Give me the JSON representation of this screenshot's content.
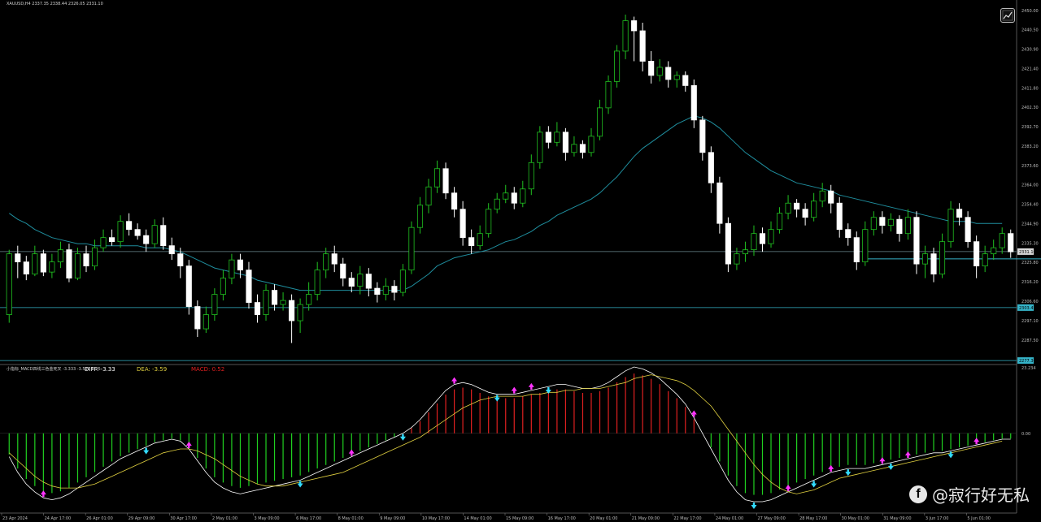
{
  "header": {
    "symbol_line": "XAUUSD,H4  2337.35 2338.44 2326.05 2331.10"
  },
  "indicator": {
    "name": "小指标_MACD四线三色金死叉 -3.333 -3.590 0.25",
    "diff": "DIFF: -3.33",
    "dea": "DEA: -3.59",
    "macd": "MACD: 0.52"
  },
  "watermark": "@寂行好无私",
  "colors": {
    "background": "#000000",
    "bull": "#20c020",
    "bear": "#ffffff",
    "ma": "#1f8e9e",
    "hline": "#35b3c8",
    "hist_pos": "#e02020",
    "hist_neg": "#20d020",
    "diff_line": "#ffffff",
    "dea_line": "#e0d040",
    "arrow_up": "#ff33ff",
    "arrow_down": "#33ddff"
  },
  "chart_data": {
    "type": "candlestick",
    "price_axis_labels": [
      "2450.00",
      "2440.50",
      "2430.90",
      "2421.40",
      "2411.80",
      "2402.30",
      "2392.70",
      "2383.20",
      "2373.60",
      "2364.00",
      "2354.40",
      "2344.90",
      "2335.30",
      "2325.80",
      "2316.20",
      "2306.60",
      "2297.10",
      "2287.50"
    ],
    "price_badges": [
      "2331.10",
      "2303.47",
      "2277.36"
    ],
    "indicator_axis_labels": [
      "23.234",
      "0.00"
    ],
    "time_labels": [
      "23 Apr 2024",
      "24 Apr 17:00",
      "26 Apr 01:00",
      "29 Apr 09:00",
      "30 Apr 17:00",
      "2 May 01:00",
      "3 May 09:00",
      "6 May 17:00",
      "8 May 01:00",
      "9 May 09:00",
      "10 May 17:00",
      "14 May 01:00",
      "15 May 09:00",
      "16 May 17:00",
      "20 May 01:00",
      "21 May 09:00",
      "22 May 17:00",
      "24 May 01:00",
      "27 May 09:00",
      "28 May 17:00",
      "30 May 01:00",
      "31 May 09:00",
      "3 Jun 17:00",
      "5 Jun 01:00"
    ],
    "y_range": [
      2277,
      2452
    ],
    "hlines": [
      2331.1,
      2303.47,
      2277.36
    ],
    "segments": [
      {
        "x0": 100,
        "x1": 122,
        "y": 2327.5
      },
      {
        "x0": 121,
        "x1": 143,
        "y": 2366.0
      },
      {
        "x0": 144,
        "x1": 162,
        "y": 2323.0
      },
      {
        "x0": 149,
        "x1": 169,
        "y": 2362.0
      },
      {
        "x0": 161,
        "x1": 183,
        "y": 2357.0
      },
      {
        "x0": 152,
        "x1": 172,
        "y": 2318.0
      }
    ],
    "macd_range": [
      -40,
      34
    ],
    "candles": [
      [
        2300,
        2330,
        2296,
        2332
      ],
      [
        2330,
        2326,
        2318,
        2334
      ],
      [
        2326,
        2320,
        2317,
        2329
      ],
      [
        2320,
        2330,
        2319,
        2334
      ],
      [
        2330,
        2321,
        2319,
        2332
      ],
      [
        2321,
        2326,
        2318,
        2330
      ],
      [
        2326,
        2332,
        2323,
        2336
      ],
      [
        2332,
        2318,
        2316,
        2335
      ],
      [
        2318,
        2330,
        2317,
        2333
      ],
      [
        2330,
        2324,
        2321,
        2334
      ],
      [
        2324,
        2333,
        2322,
        2337
      ],
      [
        2333,
        2338,
        2331,
        2342
      ],
      [
        2338,
        2336,
        2334,
        2342
      ],
      [
        2336,
        2346,
        2333,
        2349
      ],
      [
        2346,
        2342,
        2339,
        2350
      ],
      [
        2342,
        2339,
        2337,
        2345
      ],
      [
        2339,
        2335,
        2331,
        2342
      ],
      [
        2335,
        2344,
        2333,
        2347
      ],
      [
        2344,
        2334,
        2332,
        2348
      ],
      [
        2334,
        2330,
        2327,
        2338
      ],
      [
        2330,
        2324,
        2318,
        2333
      ],
      [
        2324,
        2304,
        2300,
        2327
      ],
      [
        2304,
        2293,
        2289,
        2307
      ],
      [
        2293,
        2300,
        2291,
        2304
      ],
      [
        2300,
        2310,
        2297,
        2313
      ],
      [
        2310,
        2318,
        2307,
        2322
      ],
      [
        2318,
        2327,
        2315,
        2330
      ],
      [
        2327,
        2322,
        2318,
        2330
      ],
      [
        2322,
        2306,
        2303,
        2326
      ],
      [
        2306,
        2300,
        2296,
        2310
      ],
      [
        2300,
        2312,
        2297,
        2315
      ],
      [
        2312,
        2305,
        2302,
        2315
      ],
      [
        2305,
        2307,
        2302,
        2311
      ],
      [
        2307,
        2297,
        2286,
        2310
      ],
      [
        2297,
        2305,
        2291,
        2308
      ],
      [
        2305,
        2310,
        2302,
        2316
      ],
      [
        2310,
        2322,
        2307,
        2326
      ],
      [
        2322,
        2330,
        2318,
        2333
      ],
      [
        2330,
        2325,
        2321,
        2334
      ],
      [
        2325,
        2318,
        2314,
        2328
      ],
      [
        2318,
        2314,
        2311,
        2321
      ],
      [
        2314,
        2320,
        2310,
        2324
      ],
      [
        2320,
        2313,
        2309,
        2323
      ],
      [
        2313,
        2310,
        2306,
        2316
      ],
      [
        2310,
        2314,
        2307,
        2318
      ],
      [
        2314,
        2311,
        2307,
        2317
      ],
      [
        2311,
        2322,
        2309,
        2325
      ],
      [
        2322,
        2343,
        2320,
        2346
      ],
      [
        2343,
        2354,
        2340,
        2358
      ],
      [
        2354,
        2363,
        2350,
        2367
      ],
      [
        2363,
        2372,
        2360,
        2376
      ],
      [
        2372,
        2360,
        2357,
        2375
      ],
      [
        2360,
        2352,
        2348,
        2363
      ],
      [
        2352,
        2338,
        2334,
        2356
      ],
      [
        2338,
        2334,
        2330,
        2342
      ],
      [
        2334,
        2340,
        2332,
        2344
      ],
      [
        2340,
        2352,
        2338,
        2355
      ],
      [
        2352,
        2357,
        2350,
        2360
      ],
      [
        2357,
        2360,
        2355,
        2364
      ],
      [
        2360,
        2355,
        2352,
        2363
      ],
      [
        2355,
        2362,
        2353,
        2366
      ],
      [
        2362,
        2375,
        2359,
        2379
      ],
      [
        2375,
        2390,
        2372,
        2393
      ],
      [
        2390,
        2385,
        2382,
        2393
      ],
      [
        2385,
        2390,
        2383,
        2395
      ],
      [
        2390,
        2380,
        2376,
        2392
      ],
      [
        2380,
        2384,
        2378,
        2388
      ],
      [
        2384,
        2380,
        2377,
        2386
      ],
      [
        2380,
        2388,
        2378,
        2392
      ],
      [
        2388,
        2402,
        2386,
        2406
      ],
      [
        2402,
        2415,
        2399,
        2418
      ],
      [
        2415,
        2430,
        2412,
        2433
      ],
      [
        2430,
        2445,
        2426,
        2448
      ],
      [
        2445,
        2440,
        2425,
        2447
      ],
      [
        2440,
        2425,
        2420,
        2444
      ],
      [
        2425,
        2418,
        2414,
        2430
      ],
      [
        2418,
        2422,
        2415,
        2426
      ],
      [
        2422,
        2416,
        2412,
        2425
      ],
      [
        2416,
        2418,
        2412,
        2420
      ],
      [
        2418,
        2413,
        2410,
        2420
      ],
      [
        2413,
        2396,
        2392,
        2416
      ],
      [
        2396,
        2380,
        2376,
        2398
      ],
      [
        2380,
        2365,
        2360,
        2383
      ],
      [
        2365,
        2345,
        2340,
        2368
      ],
      [
        2345,
        2325,
        2321,
        2348
      ],
      [
        2325,
        2330,
        2322,
        2333
      ],
      [
        2330,
        2332,
        2326,
        2336
      ],
      [
        2332,
        2340,
        2329,
        2344
      ],
      [
        2340,
        2335,
        2331,
        2343
      ],
      [
        2335,
        2342,
        2333,
        2346
      ],
      [
        2342,
        2350,
        2340,
        2353
      ],
      [
        2350,
        2355,
        2347,
        2359
      ],
      [
        2355,
        2352,
        2348,
        2357
      ],
      [
        2352,
        2348,
        2344,
        2355
      ],
      [
        2348,
        2356,
        2346,
        2360
      ],
      [
        2356,
        2361,
        2353,
        2365
      ],
      [
        2361,
        2355,
        2350,
        2364
      ],
      [
        2355,
        2342,
        2338,
        2358
      ],
      [
        2342,
        2338,
        2334,
        2345
      ],
      [
        2338,
        2326,
        2322,
        2341
      ],
      [
        2326,
        2342,
        2324,
        2346
      ],
      [
        2342,
        2348,
        2339,
        2351
      ],
      [
        2348,
        2344,
        2340,
        2351
      ],
      [
        2344,
        2347,
        2341,
        2350
      ],
      [
        2347,
        2340,
        2336,
        2349
      ],
      [
        2340,
        2348,
        2337,
        2352
      ],
      [
        2348,
        2325,
        2320,
        2351
      ],
      [
        2325,
        2330,
        2318,
        2334
      ],
      [
        2330,
        2320,
        2316,
        2333
      ],
      [
        2320,
        2336,
        2318,
        2340
      ],
      [
        2336,
        2352,
        2333,
        2356
      ],
      [
        2352,
        2348,
        2344,
        2355
      ],
      [
        2348,
        2336,
        2333,
        2351
      ],
      [
        2336,
        2324,
        2318,
        2339
      ],
      [
        2324,
        2330,
        2321,
        2334
      ],
      [
        2330,
        2333,
        2327,
        2337
      ],
      [
        2333,
        2340,
        2330,
        2343
      ],
      [
        2340,
        2331,
        2328,
        2342
      ]
    ],
    "ma": [
      2350,
      2347,
      2345,
      2342,
      2340,
      2338,
      2337,
      2336,
      2335,
      2335,
      2334,
      2334,
      2334,
      2334,
      2334,
      2334,
      2333,
      2333,
      2333,
      2332,
      2331,
      2329,
      2327,
      2325,
      2323,
      2322,
      2321,
      2320,
      2319,
      2317,
      2316,
      2315,
      2314,
      2313,
      2312,
      2312,
      2312,
      2312,
      2312,
      2312,
      2312,
      2312,
      2312,
      2312,
      2312,
      2312,
      2312,
      2314,
      2317,
      2320,
      2324,
      2326,
      2328,
      2329,
      2330,
      2331,
      2332,
      2334,
      2336,
      2337,
      2339,
      2341,
      2344,
      2346,
      2349,
      2351,
      2353,
      2355,
      2357,
      2360,
      2364,
      2368,
      2373,
      2378,
      2382,
      2385,
      2388,
      2391,
      2394,
      2396,
      2398,
      2397,
      2395,
      2392,
      2388,
      2384,
      2380,
      2377,
      2374,
      2371,
      2369,
      2367,
      2365,
      2364,
      2363,
      2362,
      2361,
      2359,
      2358,
      2357,
      2356,
      2355,
      2354,
      2353,
      2352,
      2351,
      2350,
      2349,
      2348,
      2347,
      2346,
      2346,
      2346,
      2345,
      2345,
      2345,
      2345
    ],
    "diff": [
      -12,
      -20,
      -26,
      -30,
      -33,
      -34,
      -33,
      -31,
      -28,
      -25,
      -22,
      -19,
      -16,
      -13,
      -11,
      -9,
      -7,
      -5,
      -4,
      -3,
      -4,
      -8,
      -14,
      -20,
      -25,
      -28,
      -30,
      -31,
      -30,
      -29,
      -28,
      -27,
      -26,
      -25,
      -24,
      -22,
      -20,
      -18,
      -16,
      -14,
      -12,
      -10,
      -8,
      -6,
      -4,
      -2,
      0,
      3,
      7,
      12,
      17,
      22,
      25,
      26,
      25,
      23,
      21,
      20,
      20,
      20,
      21,
      22,
      23,
      24,
      25,
      25,
      24,
      23,
      23,
      24,
      26,
      29,
      32,
      34,
      33,
      31,
      28,
      24,
      20,
      15,
      8,
      0,
      -8,
      -16,
      -24,
      -30,
      -34,
      -35,
      -35,
      -34,
      -32,
      -30,
      -28,
      -26,
      -24,
      -22,
      -20,
      -19,
      -18,
      -18,
      -18,
      -17,
      -16,
      -15,
      -14,
      -13,
      -12,
      -11,
      -10,
      -10,
      -9,
      -8,
      -7,
      -6,
      -5,
      -4,
      -3,
      -3
    ],
    "dea": [
      -10,
      -14,
      -18,
      -22,
      -25,
      -27,
      -28,
      -28,
      -28,
      -27,
      -26,
      -24,
      -22,
      -20,
      -18,
      -16,
      -14,
      -12,
      -10,
      -9,
      -8,
      -8,
      -9,
      -11,
      -13,
      -16,
      -19,
      -22,
      -24,
      -26,
      -27,
      -27,
      -27,
      -26,
      -25,
      -24,
      -23,
      -22,
      -21,
      -20,
      -18,
      -16,
      -14,
      -12,
      -10,
      -8,
      -6,
      -4,
      -2,
      1,
      4,
      7,
      10,
      13,
      15,
      17,
      18,
      19,
      19,
      19,
      19,
      20,
      20,
      21,
      21,
      22,
      22,
      23,
      23,
      23,
      24,
      25,
      26,
      28,
      29,
      30,
      29,
      28,
      27,
      25,
      22,
      18,
      14,
      8,
      2,
      -4,
      -10,
      -16,
      -21,
      -25,
      -28,
      -30,
      -31,
      -30,
      -29,
      -27,
      -25,
      -23,
      -22,
      -21,
      -20,
      -19,
      -18,
      -17,
      -16,
      -15,
      -14,
      -13,
      -12,
      -11,
      -10,
      -9,
      -8,
      -7,
      -6,
      -5,
      -4
    ],
    "arrows_up": [
      10,
      54,
      100,
      128,
      145,
      150,
      198,
      224,
      236,
      251,
      260,
      278
    ],
    "arrows_down": [
      40,
      86,
      114,
      141,
      157,
      215,
      232,
      243,
      255,
      271
    ]
  }
}
